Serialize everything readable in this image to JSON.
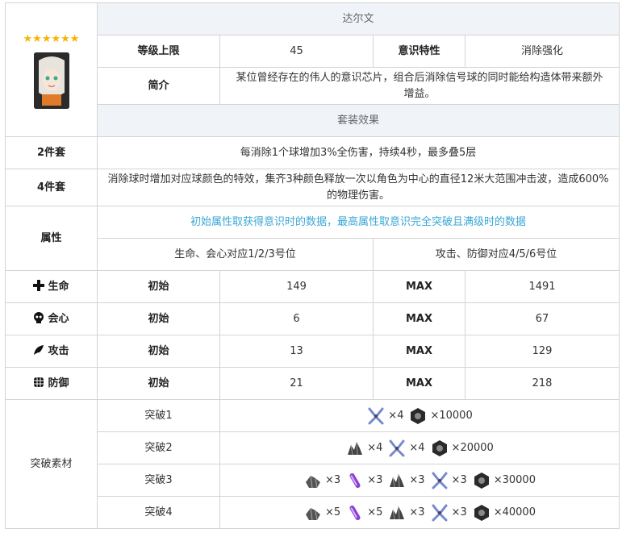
{
  "stars": "★★★★★★",
  "name": "达尔文",
  "level_cap_label": "等级上限",
  "level_cap_value": "45",
  "trait_label": "意识特性",
  "trait_value": "消除强化",
  "intro_label": "简介",
  "intro_text": "某位曾经存在的伟人的意识芯片，组合后消除信号球的同时能给构造体带来额外增益。",
  "set_effect_header": "套装效果",
  "set2_label": "2件套",
  "set2_text": "每消除1个球增加3%全伤害，持续4秒，最多叠5层",
  "set4_label": "4件套",
  "set4_text": "消除球时增加对应球颜色的特效，集齐3种颜色释放一次以角色为中心的直径12米大范围冲击波，造成600%的物理伤害。",
  "attr_label": "属性",
  "attr_note": "初始属性取获得意识时的数据，最高属性取意识完全突破且满级时的数据",
  "slots_left": "生命、会心对应1/2/3号位",
  "slots_right": "攻击、防御对应4/5/6号位",
  "init_label": "初始",
  "max_label": "MAX",
  "stats": [
    {
      "name": "生命",
      "icon": "plus-icon",
      "init": "149",
      "max": "1491"
    },
    {
      "name": "会心",
      "icon": "skull-icon",
      "init": "6",
      "max": "67"
    },
    {
      "name": "攻击",
      "icon": "feather-icon",
      "init": "13",
      "max": "129"
    },
    {
      "name": "防御",
      "icon": "shield-grid-icon",
      "init": "21",
      "max": "218"
    }
  ],
  "breakthrough_label": "突破素材",
  "breakthroughs": [
    {
      "label": "突破1",
      "items": [
        {
          "icon": "tool-icon",
          "qty": "×4"
        },
        {
          "icon": "nut-icon",
          "qty": "×10000"
        }
      ]
    },
    {
      "label": "突破2",
      "items": [
        {
          "icon": "ore-icon",
          "qty": "×4"
        },
        {
          "icon": "tool-icon",
          "qty": "×4"
        },
        {
          "icon": "nut-icon",
          "qty": "×20000"
        }
      ]
    },
    {
      "label": "突破3",
      "items": [
        {
          "icon": "crystal-icon",
          "qty": "×3"
        },
        {
          "icon": "purple-tube-icon",
          "qty": "×3"
        },
        {
          "icon": "ore-icon",
          "qty": "×3"
        },
        {
          "icon": "tool-icon",
          "qty": "×3"
        },
        {
          "icon": "nut-icon",
          "qty": "×30000"
        }
      ]
    },
    {
      "label": "突破4",
      "items": [
        {
          "icon": "crystal-icon",
          "qty": "×5"
        },
        {
          "icon": "purple-tube-icon",
          "qty": "×5"
        },
        {
          "icon": "ore-icon",
          "qty": "×3"
        },
        {
          "icon": "tool-icon",
          "qty": "×3"
        },
        {
          "icon": "nut-icon",
          "qty": "×40000"
        }
      ]
    }
  ]
}
